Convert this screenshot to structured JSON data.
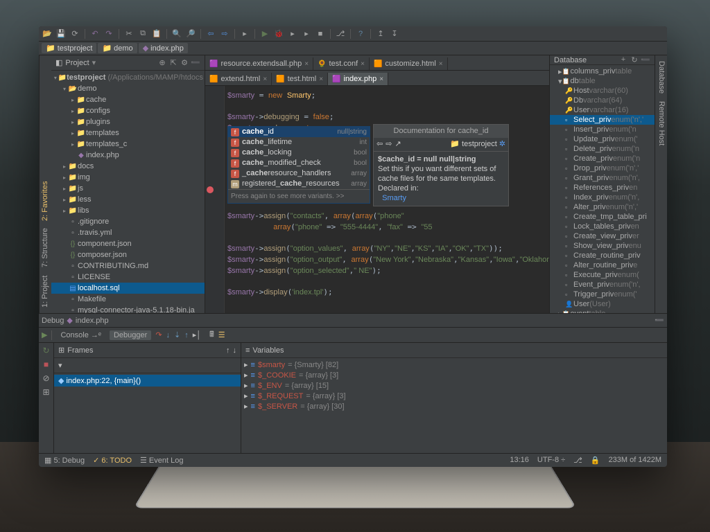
{
  "breadcrumbs": [
    "testproject",
    "demo",
    "index.php"
  ],
  "gutters": {
    "left": [
      "1: Project",
      "7: Structure",
      "2: Favorites"
    ],
    "right": [
      "Database",
      "Remote Host"
    ]
  },
  "project": {
    "title": "Project",
    "root": "testproject",
    "rootPath": "(/Applications/MAMP/htdocs",
    "items": [
      {
        "d": 1,
        "t": "folder-open",
        "l": "demo",
        "a": "▾"
      },
      {
        "d": 2,
        "t": "folder",
        "l": "cache",
        "a": "▸"
      },
      {
        "d": 2,
        "t": "folder",
        "l": "configs",
        "a": "▸"
      },
      {
        "d": 2,
        "t": "folder",
        "l": "plugins",
        "a": "▸"
      },
      {
        "d": 2,
        "t": "folder",
        "l": "templates",
        "a": "▸"
      },
      {
        "d": 2,
        "t": "folder",
        "l": "templates_c",
        "a": "▸"
      },
      {
        "d": 2,
        "t": "php",
        "l": "index.php",
        "a": ""
      },
      {
        "d": 1,
        "t": "folder",
        "l": "docs",
        "a": "▸"
      },
      {
        "d": 1,
        "t": "folder",
        "l": "img",
        "a": "▸"
      },
      {
        "d": 1,
        "t": "folder",
        "l": "js",
        "a": "▸"
      },
      {
        "d": 1,
        "t": "folder",
        "l": "less",
        "a": "▸"
      },
      {
        "d": 1,
        "t": "folder",
        "l": "libs",
        "a": "▸"
      },
      {
        "d": 1,
        "t": "file",
        "l": ".gitignore",
        "a": ""
      },
      {
        "d": 1,
        "t": "file",
        "l": ".travis.yml",
        "a": ""
      },
      {
        "d": 1,
        "t": "json",
        "l": "component.json",
        "a": ""
      },
      {
        "d": 1,
        "t": "json",
        "l": "composer.json",
        "a": ""
      },
      {
        "d": 1,
        "t": "md",
        "l": "CONTRIBUTING.md",
        "a": ""
      },
      {
        "d": 1,
        "t": "file",
        "l": "LICENSE",
        "a": ""
      },
      {
        "d": 1,
        "t": "sql",
        "l": "localhost.sql",
        "a": "",
        "sel": true
      },
      {
        "d": 1,
        "t": "file",
        "l": "Makefile",
        "a": ""
      },
      {
        "d": 1,
        "t": "file",
        "l": "mysql-connector-java-5.1.18-bin.ja",
        "a": ""
      }
    ]
  },
  "tabs_row1": [
    {
      "ic": "🟪",
      "l": "resource.extendsall.php"
    },
    {
      "ic": "🌻",
      "l": "test.conf"
    },
    {
      "ic": "🟧",
      "l": "customize.html"
    }
  ],
  "tabs_row2": [
    {
      "ic": "🟧",
      "l": "extend.html"
    },
    {
      "ic": "🟧",
      "l": "test.html"
    },
    {
      "ic": "🟪",
      "l": "index.php",
      "active": true
    }
  ],
  "completion": {
    "sel": {
      "ic": "F",
      "l": "cache_id",
      "type": "null|string"
    },
    "items": [
      {
        "ic": "F",
        "l": "cache_lifetime",
        "type": "int"
      },
      {
        "ic": "F",
        "l": "cache_locking",
        "type": "bool"
      },
      {
        "ic": "F",
        "l": "cache_modified_check",
        "type": "bool"
      },
      {
        "ic": "F",
        "l": "_cacheresource_handlers",
        "type": "array"
      },
      {
        "ic": "M",
        "l": "registered_cache_resources",
        "type": "array"
      }
    ],
    "hint": "Press again to see more variants. >>"
  },
  "doc": {
    "title": "Documentation for cache_id",
    "project": "testproject",
    "body1": "$cache_id = null null|string",
    "body2": "Set this if you want different sets of cache files for the same templates.",
    "decl": "Declared in:",
    "link": "Smarty"
  },
  "database": {
    "title": "Database",
    "items": [
      {
        "d": 1,
        "a": "▸",
        "ic": "📋",
        "l": "columns_priv",
        "dim": "table"
      },
      {
        "d": 1,
        "a": "▾",
        "ic": "📋",
        "l": "db",
        "dim": "table"
      },
      {
        "d": 2,
        "ic": "🔑",
        "l": "Host",
        "dim": "varchar(60)"
      },
      {
        "d": 2,
        "ic": "🔑",
        "l": "Db",
        "dim": "varchar(64)"
      },
      {
        "d": 2,
        "ic": "🔑",
        "l": "User",
        "dim": "varchar(16)"
      },
      {
        "d": 2,
        "ic": "▫",
        "l": "Select_priv",
        "dim": "enum('n','",
        "sel": true
      },
      {
        "d": 2,
        "ic": "▫",
        "l": "Insert_priv",
        "dim": "enum('n"
      },
      {
        "d": 2,
        "ic": "▫",
        "l": "Update_priv",
        "dim": "enum('"
      },
      {
        "d": 2,
        "ic": "▫",
        "l": "Delete_priv",
        "dim": "enum('n"
      },
      {
        "d": 2,
        "ic": "▫",
        "l": "Create_priv",
        "dim": "enum('n"
      },
      {
        "d": 2,
        "ic": "▫",
        "l": "Drop_priv",
        "dim": "enum('n','"
      },
      {
        "d": 2,
        "ic": "▫",
        "l": "Grant_priv",
        "dim": "enum('n',"
      },
      {
        "d": 2,
        "ic": "▫",
        "l": "References_priv",
        "dim": "en"
      },
      {
        "d": 2,
        "ic": "▫",
        "l": "Index_priv",
        "dim": "enum('n',"
      },
      {
        "d": 2,
        "ic": "▫",
        "l": "Alter_priv",
        "dim": "enum('n','"
      },
      {
        "d": 2,
        "ic": "▫",
        "l": "Create_tmp_table_pri"
      },
      {
        "d": 2,
        "ic": "▫",
        "l": "Lock_tables_priv",
        "dim": "en"
      },
      {
        "d": 2,
        "ic": "▫",
        "l": "Create_view_priv",
        "dim": "er"
      },
      {
        "d": 2,
        "ic": "▫",
        "l": "Show_view_priv",
        "dim": "enu"
      },
      {
        "d": 2,
        "ic": "▫",
        "l": "Create_routine_priv"
      },
      {
        "d": 2,
        "ic": "▫",
        "l": "Alter_routine_priv",
        "dim": "e"
      },
      {
        "d": 2,
        "ic": "▫",
        "l": "Execute_priv",
        "dim": "enum("
      },
      {
        "d": 2,
        "ic": "▫",
        "l": "Event_priv",
        "dim": "enum('n',"
      },
      {
        "d": 2,
        "ic": "▫",
        "l": "Trigger_priv",
        "dim": "enum('"
      },
      {
        "d": 2,
        "ic": "👤",
        "l": "User",
        "dim": "(User)"
      },
      {
        "d": 1,
        "a": "▸",
        "ic": "📋",
        "l": "event",
        "dim": "table"
      }
    ]
  },
  "debug": {
    "label": "Debug",
    "file": "index.php",
    "consoletab": "Console",
    "debuggertab": "Debugger",
    "frames": "Frames",
    "frame": "index.php:22, {main}()",
    "vars": "Variables",
    "varlist": [
      {
        "n": "$smarty",
        "v": "= {Smarty} [82]"
      },
      {
        "n": "$_COOKIE",
        "v": "= {array} [3]"
      },
      {
        "n": "$_ENV",
        "v": "= {array} [15]"
      },
      {
        "n": "$_REQUEST",
        "v": "= {array} [3]"
      },
      {
        "n": "$_SERVER",
        "v": "= {array} [30]"
      }
    ]
  },
  "status": {
    "debug": "5: Debug",
    "todo": "6: TODO",
    "eventlog": "Event Log",
    "time": "13:16",
    "enc": "UTF-8 ÷",
    "mem": "233M of 1422M"
  }
}
